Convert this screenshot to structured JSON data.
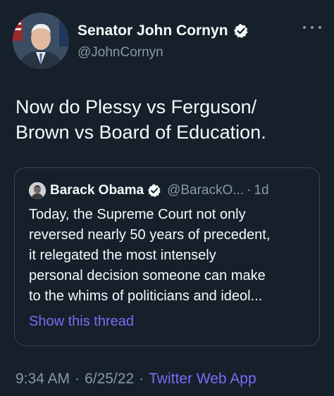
{
  "author": {
    "name": "Senator John Cornyn",
    "handle": "@JohnCornyn",
    "verified": true
  },
  "tweet": {
    "text_lines": [
      "Now do Plessy vs Ferguson/",
      "Brown vs Board of Education."
    ]
  },
  "quoted": {
    "name": "Barack Obama",
    "handle": "@BarackO...",
    "separator": "·",
    "age": "1d",
    "verified": true,
    "text_lines": [
      "Today, the Supreme Court not only",
      "reversed nearly 50 years of precedent,",
      "it relegated the most intensely",
      "personal decision someone can make",
      "to the whims of politicians and ideol..."
    ],
    "show_thread": "Show this thread"
  },
  "footer": {
    "time": "9:34 AM",
    "date": "6/25/22",
    "separator": "·",
    "source": "Twitter Web App"
  },
  "icons": {
    "verified": "verified-badge-icon",
    "more": "more-options-icon"
  },
  "colors": {
    "background": "#15202b",
    "text": "#f7f9f9",
    "muted": "#8b98a5",
    "link": "#7b6cf6",
    "border": "#38444d"
  }
}
